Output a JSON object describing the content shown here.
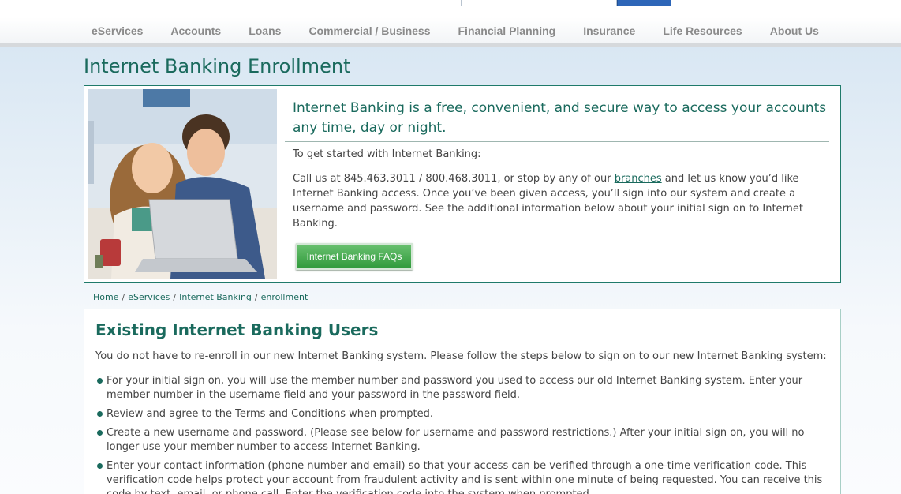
{
  "nav": {
    "items": [
      "eServices",
      "Accounts",
      "Loans",
      "Commercial / Business",
      "Financial Planning",
      "Insurance",
      "Life Resources",
      "About Us"
    ]
  },
  "page_title": "Internet Banking Enrollment",
  "hero": {
    "headline": "Internet Banking is a free, convenient, and secure way to access your accounts any time, day or night.",
    "intro": "To get started with Internet Banking:",
    "body_before_link": "Call us at 845.463.3011 / 800.468.3011, or stop by any of our ",
    "link_text": "branches",
    "body_after_link": " and let us know you’d like Internet Banking access. Once you’ve been given access, you’ll sign into our system and create a username and password. See the additional information below about your initial sign on to Internet Banking.",
    "faq_button": "Internet Banking FAQs"
  },
  "breadcrumb": [
    "Home",
    "eServices",
    "Internet Banking",
    "enrollment"
  ],
  "existing_users": {
    "title": "Existing Internet Banking Users",
    "intro": "You do not have to re-enroll in our new Internet Banking system. Please follow the steps below to sign on to our new Internet Banking system:",
    "steps": [
      "For your initial sign on, you will use the member number and password you used to access our old Internet Banking system. Enter your member number in the username field and your password in the password field.",
      "Review and agree to the Terms and Conditions when prompted.",
      "Create a new username and password. (Please see below for username and password restrictions.) After your initial sign on, you will no longer use your member number to access Internet Banking.",
      "Enter your contact information (phone number and email) so that your access can be verified through a one-time verification code. This verification code helps protect your account from fraudulent activity and is sent within one minute of being requested. You can receive this code by text, email, or phone call. Enter the verification code into the system when prompted."
    ]
  },
  "colors": {
    "brand_green": "#1a6a5d",
    "button_green": "#2f9a3b",
    "nav_text": "#8a8a8a"
  }
}
